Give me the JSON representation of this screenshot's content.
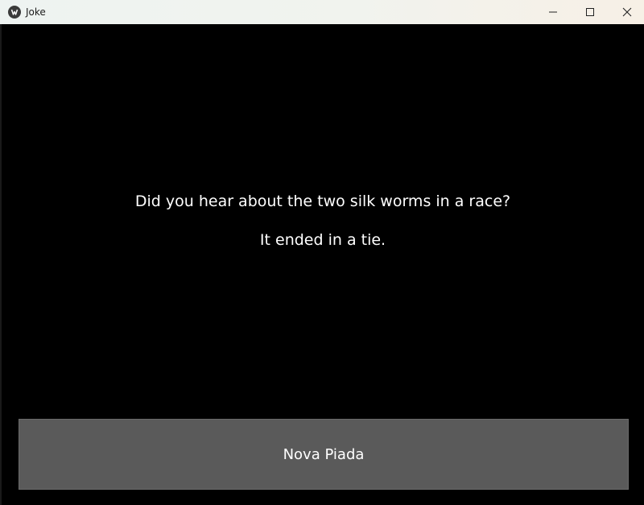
{
  "window": {
    "title": "Joke",
    "icon": "app-icon",
    "controls": {
      "minimize_icon": "minimize-icon",
      "maximize_icon": "maximize-icon",
      "close_icon": "close-icon"
    }
  },
  "joke": {
    "setup": "Did you hear about the two silk worms in a race?",
    "punchline": "It ended in a tie."
  },
  "actions": {
    "new_joke_label": "Nova Piada"
  },
  "colors": {
    "background": "#000000",
    "button_bg": "#5a5a5a",
    "text": "#ffffff"
  }
}
